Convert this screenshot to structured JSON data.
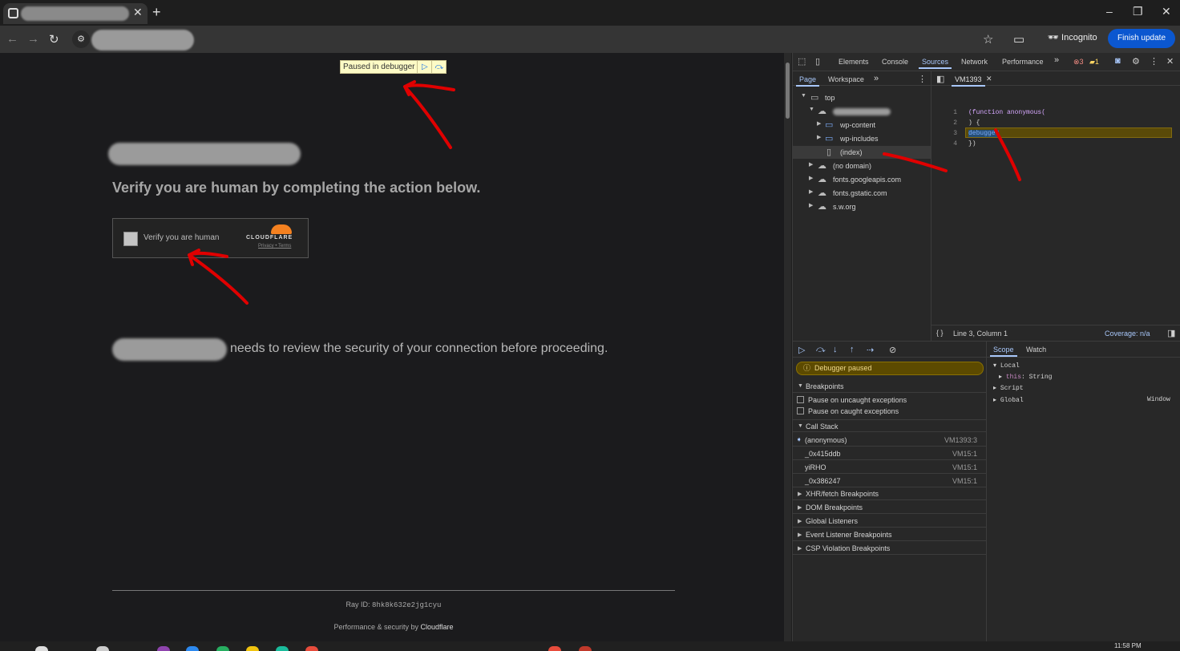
{
  "browser": {
    "new_tab": "+",
    "close_tab": "✕",
    "win_min": "–",
    "win_max": "❐",
    "win_close": "✕",
    "incognito_label": "Incognito",
    "finish_update_label": "Finish update"
  },
  "page": {
    "paused_label": "Paused in debugger",
    "heading": "Verify you are human by completing the action below.",
    "checkbox_label": "Verify you are human",
    "cloudflare_wordmark": "CLOUDFLARE",
    "privacy_link": "Privacy",
    "terms_separator": "•",
    "terms_link": "Terms",
    "review_text": "needs to review the security of your connection before proceeding.",
    "ray_label": "Ray ID: ",
    "ray_id": "8hk8k632e2jg1cyu",
    "perf_label": "Performance & security by ",
    "perf_brand": "Cloudflare"
  },
  "devtools": {
    "tabs": [
      "Elements",
      "Console",
      "Sources",
      "Network",
      "Performance"
    ],
    "more_tabs": "»",
    "errors_count": "3",
    "warnings_count": "1",
    "subtabs": [
      "Page",
      "Workspace"
    ],
    "tree": {
      "top": "top",
      "folders": [
        "wp-content",
        "wp-includes"
      ],
      "index": "(index)",
      "domains": [
        "(no domain)",
        "fonts.googleapis.com",
        "fonts.gstatic.com",
        "s.w.org"
      ]
    },
    "file_tab": "VM1393",
    "code_lines": [
      {
        "n": "1",
        "text": "(function anonymous("
      },
      {
        "n": "2",
        "text": ") {"
      },
      {
        "n": "3",
        "text": "debugger"
      },
      {
        "n": "4",
        "text": "})"
      }
    ],
    "cursor_position": "Line 3, Column 1",
    "coverage": "Coverage: n/a",
    "debugger_paused": "Debugger paused",
    "breakpoints": "Breakpoints",
    "pause_uncaught": "Pause on uncaught exceptions",
    "pause_caught": "Pause on caught exceptions",
    "call_stack": "Call Stack",
    "frames": [
      {
        "name": "(anonymous)",
        "loc": "VM1393:3"
      },
      {
        "name": "_0x415ddb",
        "loc": "VM15:1"
      },
      {
        "name": "yiRHO",
        "loc": "VM15:1"
      },
      {
        "name": "_0x386247",
        "loc": "VM15:1"
      }
    ],
    "sections": [
      "XHR/fetch Breakpoints",
      "DOM Breakpoints",
      "Global Listeners",
      "Event Listener Breakpoints",
      "CSP Violation Breakpoints"
    ],
    "scope_tab": "Scope",
    "watch_tab": "Watch",
    "scope": {
      "local": "Local",
      "this_key": "this",
      "this_val": ": String",
      "script": "Script",
      "global": "Global",
      "global_val": "Window"
    }
  },
  "taskbar": {
    "clock": "11:58 PM"
  }
}
